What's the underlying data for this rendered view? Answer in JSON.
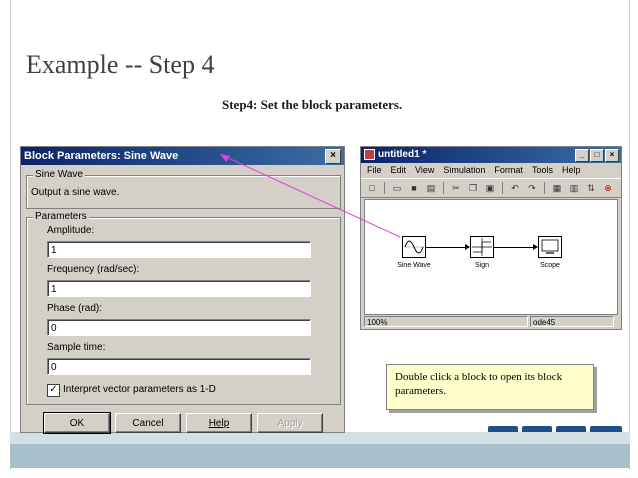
{
  "slide": {
    "title": "Example -- Step 4",
    "subtitle": "Step4: Set the block parameters."
  },
  "dialog": {
    "title": "Block Parameters: Sine Wave",
    "close_glyph": "×",
    "block_group": "Sine Wave",
    "description": "Output a sine wave.",
    "params_group": "Parameters",
    "fields": [
      {
        "label": "Amplitude:",
        "value": "1"
      },
      {
        "label": "Frequency (rad/sec):",
        "value": "1"
      },
      {
        "label": "Phase (rad):",
        "value": "0"
      },
      {
        "label": "Sample time:",
        "value": "0"
      }
    ],
    "checkbox_label": "Interpret vector parameters as 1-D",
    "checkbox_checked": true,
    "buttons": {
      "ok": "OK",
      "cancel": "Cancel",
      "help": "Help",
      "apply": "Apply"
    }
  },
  "model_window": {
    "title": "untitled1 *",
    "window_buttons": [
      "_",
      "□",
      "×"
    ],
    "menu": [
      "File",
      "Edit",
      "View",
      "Simulation",
      "Format",
      "Tools",
      "Help"
    ],
    "toolbar_icons": [
      "new-icon",
      "open-icon",
      "save-icon",
      "print-icon",
      "cut-icon",
      "copy-icon",
      "paste-icon",
      "undo-icon",
      "redo-icon",
      "library-icon",
      "explorer-icon",
      "debug-icon",
      "stop-icon"
    ],
    "blocks": [
      {
        "name": "sine-wave-block",
        "label": "Sine Wave"
      },
      {
        "name": "sign-block",
        "label": "Sign"
      },
      {
        "name": "scope-block",
        "label": "Scope"
      }
    ],
    "status_zoom": "100%",
    "status_solver": "ode45"
  },
  "note": {
    "text": "Double click a block to open its block parameters."
  },
  "colors": {
    "title_bar": "#0a246a",
    "dialog_bg": "#d4d0c8",
    "note_bg": "#ffffcc",
    "pointer_line": "#e040e0"
  }
}
